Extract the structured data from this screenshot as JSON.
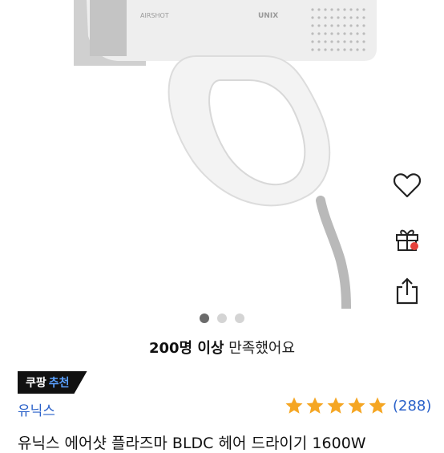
{
  "product_image": {
    "body_label": "AIRSHOT",
    "brand_mark": "UNIX",
    "alt": "product-photo"
  },
  "actions": {
    "wishlist_icon": "heart-icon",
    "gift_icon": "gift-icon",
    "share_icon": "share-icon"
  },
  "carousel": {
    "total": 3,
    "active_index": 0
  },
  "satisfaction": {
    "count": "200명 이상",
    "text": "만족했어요"
  },
  "badge": {
    "prefix": "쿠팡",
    "accent": "추천"
  },
  "brand": {
    "name": "유닉스"
  },
  "rating": {
    "stars": 5,
    "max": 5,
    "count_label": "(288)"
  },
  "product_title": "유닉스 에어샷 플라즈마 BLDC 헤어 드라이기 1600W",
  "colors": {
    "star": "#f5a623",
    "link": "#2a61c9",
    "badge_bg": "#111111",
    "badge_accent": "#5aa0ff"
  }
}
